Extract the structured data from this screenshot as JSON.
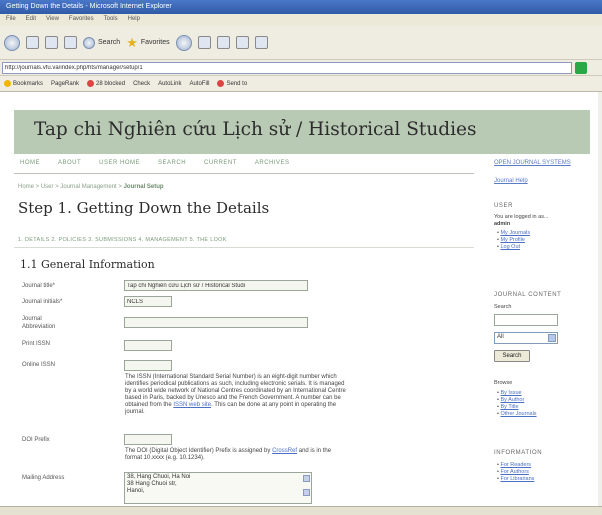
{
  "window": {
    "title": "Getting Down the Details - Microsoft Internet Explorer"
  },
  "menubar": [
    "File",
    "Edit",
    "View",
    "Favorites",
    "Tools",
    "Help"
  ],
  "toolbar": {
    "search_label": "Search",
    "favorites_label": "Favorites"
  },
  "address": {
    "url": "http://journals.vfu.va/index.php/hts/manager/setup/1"
  },
  "linksbar": {
    "items": [
      "Bookmarks",
      "PageRank",
      "28 blocked",
      "Check",
      "AutoLink",
      "AutoFill",
      "Send to"
    ]
  },
  "site": {
    "title": "Tap chi Nghiên cứu Lịch sử / Historical Studies"
  },
  "nav": [
    "HOME",
    "ABOUT",
    "USER HOME",
    "SEARCH",
    "CURRENT",
    "ARCHIVES"
  ],
  "breadcrumb": {
    "prefix": "Home > User > Journal Management >",
    "current": "Journal Setup"
  },
  "page": {
    "title": "Step 1. Getting Down the Details",
    "steps": "1. DETAILS  2. POLICIES  3. SUBMISSIONS  4. MANAGEMENT  5. THE LOOK",
    "section": "1.1 General Information"
  },
  "form": {
    "journal_title_label": "Journal title*",
    "journal_title_value": "Tap chi Nghiên cứu Lịch sử / Historical Studi",
    "journal_initials_label": "Journal initials*",
    "journal_initials_value": "NCLS",
    "abbrev_label_1": "Journal",
    "abbrev_label_2": "Abbreviation",
    "print_issn_label": "Print ISSN",
    "online_issn_label": "Online ISSN",
    "issn_help_1": "The ISSN (International Standard Serial Number) is an eight-digit number which",
    "issn_help_2": "identifies periodical publications as such, including electronic serials. It is managed",
    "issn_help_3": "by a world wide network of National Centres coordinated by an International Centre",
    "issn_help_4": "based in Paris, backed by Unesco and the French Government. A number can be",
    "issn_help_5_pre": "obtained from the",
    "issn_help_5_link": "ISSN web site",
    "issn_help_5_post": ". This can be done at any point in operating the",
    "issn_help_6": "journal.",
    "doi_label": "DOI Prefix",
    "doi_help_1_pre": "The DOI (Digital Object Identifier) Prefix is assigned by",
    "doi_help_1_link": "CrossRef",
    "doi_help_1_post": "and is in the",
    "doi_help_2": "format 10.xxxx (e.g. 10.1234).",
    "mailing_label": "Mailing Address",
    "mailing_lines": [
      "38, Hang Chuoi, Ha Noi",
      "38 Hang Chuoi str,",
      "Hanoi,"
    ]
  },
  "sidebar": {
    "top_link": "OPEN JOURNAL SYSTEMS",
    "help_link": "Journal Help",
    "user_head": "USER",
    "logged_in": "You are logged in as...",
    "username": "admin",
    "user_links": [
      "My Journals",
      "My Profile",
      "Log Out"
    ],
    "content_head": "JOURNAL CONTENT",
    "search_label": "Search",
    "select_value": "All",
    "search_button": "Search",
    "browse_label": "Browse",
    "browse_links": [
      "By Issue",
      "By Author",
      "By Title",
      "Other Journals"
    ],
    "info_head": "INFORMATION",
    "info_links": [
      "For Readers",
      "For Authors",
      "For Librarians"
    ]
  }
}
